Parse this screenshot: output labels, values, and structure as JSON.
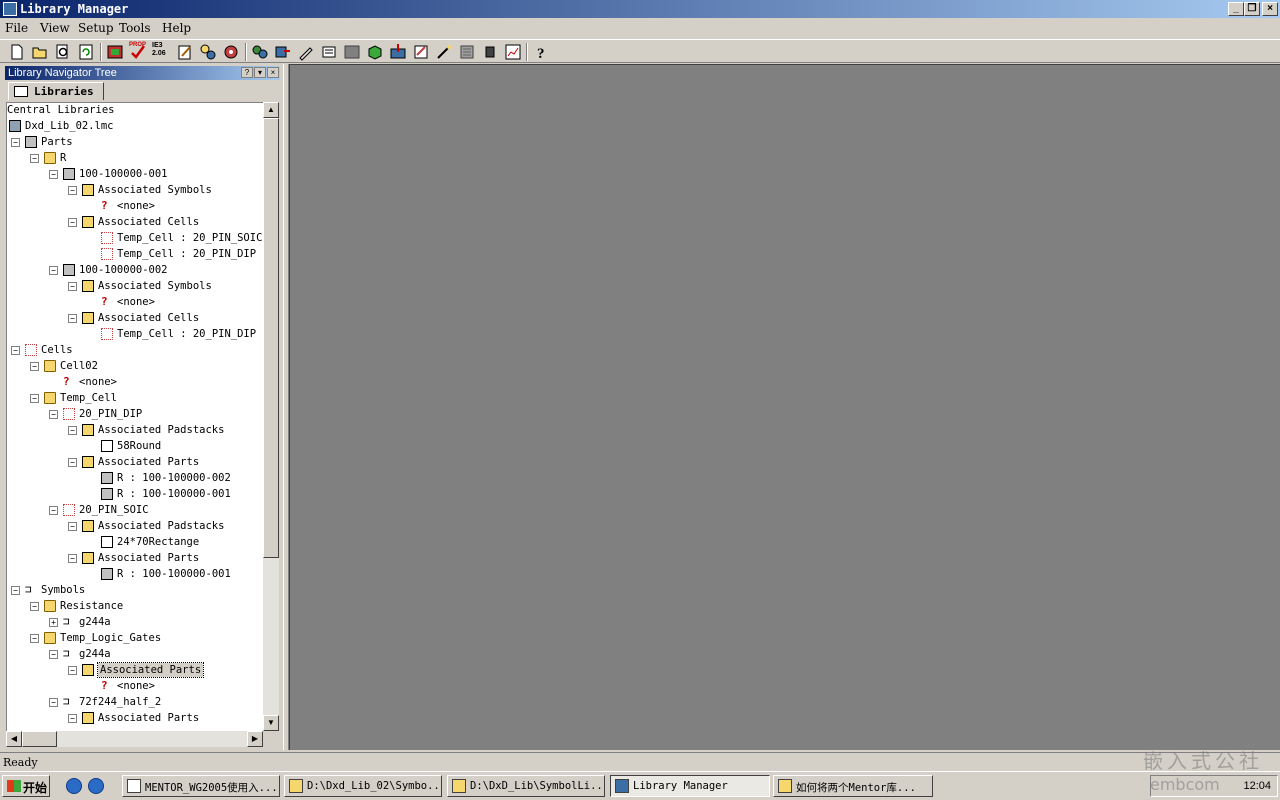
{
  "window": {
    "title": "Library Manager"
  },
  "menu": [
    "File",
    "View",
    "Setup",
    "Tools",
    "Help"
  ],
  "toolbar": {
    "icons": [
      "new-icon",
      "open-icon",
      "find-icon",
      "refresh-icon",
      "part-editor-icon",
      "verify-icon",
      "prop-icon",
      "ies-icon",
      "edit-icon",
      "settings-icon",
      "tools-icon",
      "symbol-icon",
      "padstack-icon",
      "cell-icon",
      "gray-icon",
      "3d-icon",
      "import-icon",
      "export-icon",
      "wizard-icon",
      "list-icon",
      "chip-icon",
      "report-icon",
      "help-icon"
    ],
    "text_prop": "PROP",
    "text_ies": "IE3 2.06"
  },
  "navigator": {
    "title": "Library Navigator Tree",
    "tab_label": "Libraries",
    "nodes": [
      {
        "label": "Central Libraries",
        "icon": "none",
        "level": 0,
        "expander": ""
      },
      {
        "label": "Dxd_Lib_02.lmc",
        "icon": "lib",
        "level": 0,
        "expander": ""
      },
      {
        "label": "Parts",
        "icon": "partico",
        "level": 1,
        "expander": "-"
      },
      {
        "label": "R",
        "icon": "folder",
        "level": 2,
        "expander": "-"
      },
      {
        "label": "100-100000-001",
        "icon": "partico",
        "level": 3,
        "expander": "-"
      },
      {
        "label": "Associated Symbols",
        "icon": "assoc",
        "level": 4,
        "expander": "-"
      },
      {
        "label": "<none>",
        "icon": "qico",
        "level": 5,
        "expander": ""
      },
      {
        "label": "Associated Cells",
        "icon": "assoc",
        "level": 4,
        "expander": "-"
      },
      {
        "label": "Temp_Cell : 20_PIN_SOIC",
        "icon": "cellico",
        "level": 5,
        "expander": ""
      },
      {
        "label": "Temp_Cell : 20_PIN_DIP",
        "icon": "cellico",
        "level": 5,
        "expander": ""
      },
      {
        "label": "100-100000-002",
        "icon": "partico",
        "level": 3,
        "expander": "-"
      },
      {
        "label": "Associated Symbols",
        "icon": "assoc",
        "level": 4,
        "expander": "-"
      },
      {
        "label": "<none>",
        "icon": "qico",
        "level": 5,
        "expander": ""
      },
      {
        "label": "Associated Cells",
        "icon": "assoc",
        "level": 4,
        "expander": "-"
      },
      {
        "label": "Temp_Cell : 20_PIN_DIP",
        "icon": "cellico",
        "level": 5,
        "expander": ""
      },
      {
        "label": "Cells",
        "icon": "cellico",
        "level": 1,
        "expander": "-"
      },
      {
        "label": "Cell02",
        "icon": "folder",
        "level": 2,
        "expander": "-"
      },
      {
        "label": "<none>",
        "icon": "qico",
        "level": 3,
        "expander": ""
      },
      {
        "label": "Temp_Cell",
        "icon": "folder",
        "level": 2,
        "expander": "-"
      },
      {
        "label": "20_PIN_DIP",
        "icon": "cellico",
        "level": 3,
        "expander": "-"
      },
      {
        "label": "Associated Padstacks",
        "icon": "assoc",
        "level": 4,
        "expander": "-"
      },
      {
        "label": "58Round",
        "icon": "padico",
        "level": 5,
        "expander": ""
      },
      {
        "label": "Associated Parts",
        "icon": "assoc",
        "level": 4,
        "expander": "-"
      },
      {
        "label": "R : 100-100000-002",
        "icon": "partico",
        "level": 5,
        "expander": ""
      },
      {
        "label": "R : 100-100000-001",
        "icon": "partico",
        "level": 5,
        "expander": ""
      },
      {
        "label": "20_PIN_SOIC",
        "icon": "cellico",
        "level": 3,
        "expander": "-"
      },
      {
        "label": "Associated Padstacks",
        "icon": "assoc",
        "level": 4,
        "expander": "-"
      },
      {
        "label": "24*70Rectange",
        "icon": "padico",
        "level": 5,
        "expander": ""
      },
      {
        "label": "Associated Parts",
        "icon": "assoc",
        "level": 4,
        "expander": "-"
      },
      {
        "label": "R : 100-100000-001",
        "icon": "partico",
        "level": 5,
        "expander": ""
      },
      {
        "label": "Symbols",
        "icon": "symico",
        "level": 1,
        "expander": "-"
      },
      {
        "label": "Resistance",
        "icon": "folder",
        "level": 2,
        "expander": "-"
      },
      {
        "label": "g244a",
        "icon": "symico",
        "level": 3,
        "expander": "+"
      },
      {
        "label": "Temp_Logic_Gates",
        "icon": "folder",
        "level": 2,
        "expander": "-"
      },
      {
        "label": "g244a",
        "icon": "symico",
        "level": 3,
        "expander": "-"
      },
      {
        "label": "Associated Parts",
        "icon": "assoc",
        "level": 4,
        "expander": "-",
        "selected": true
      },
      {
        "label": "<none>",
        "icon": "qico",
        "level": 5,
        "expander": ""
      },
      {
        "label": "72f244_half_2",
        "icon": "symico",
        "level": 3,
        "expander": "-"
      },
      {
        "label": "Associated Parts",
        "icon": "assoc",
        "level": 4,
        "expander": "-"
      }
    ]
  },
  "status": {
    "text": "Ready"
  },
  "taskbar": {
    "start_label": "开始",
    "tasks": [
      {
        "label": "MENTOR_WG2005使用入...",
        "active": false
      },
      {
        "label": "D:\\Dxd_Lib_02\\Symbo...",
        "active": false
      },
      {
        "label": "D:\\DxD_Lib\\SymbolLi...",
        "active": false
      },
      {
        "label": "Library Manager",
        "active": true
      },
      {
        "label": "如何将两个Mentor库...",
        "active": false
      }
    ],
    "clock": "12:04"
  },
  "watermark": {
    "line1": "嵌入式公社",
    "line2": "embcom"
  }
}
